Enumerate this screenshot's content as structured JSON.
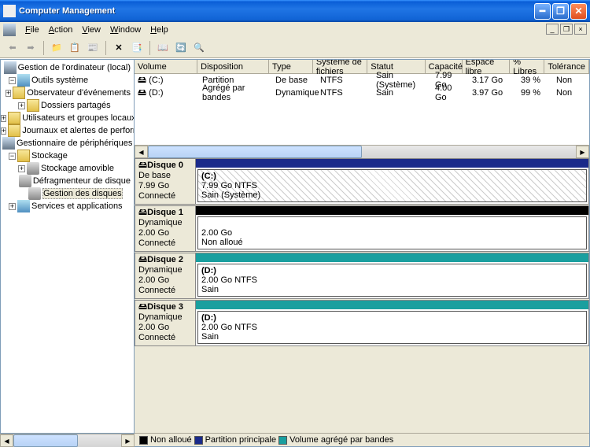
{
  "title": "Computer Management",
  "menubar": {
    "file": "File",
    "action": "Action",
    "view": "View",
    "window": "Window",
    "help": "Help"
  },
  "tree": {
    "root": "Gestion de l'ordinateur (local)",
    "outils": "Outils système",
    "obs": "Observateur d'événements",
    "dossiers": "Dossiers partagés",
    "users": "Utilisateurs et groupes locaux",
    "log": "Journaux et alertes de performance",
    "dev": "Gestionnaire de périphériques",
    "stockage": "Stockage",
    "amovible": "Stockage amovible",
    "defrag": "Défragmenteur de disque",
    "gestion": "Gestion des disques",
    "services": "Services et applications"
  },
  "vol_headers": {
    "volume": "Volume",
    "disposition": "Disposition",
    "type": "Type",
    "fs": "Système de fichiers",
    "statut": "Statut",
    "capacite": "Capacité",
    "libre": "Espace libre",
    "pct": "% Libres",
    "tol": "Tolérance"
  },
  "vols": [
    {
      "name": "(C:)",
      "dispo": "Partition",
      "type": "De base",
      "fs": "NTFS",
      "statut": "Sain (Système)",
      "cap": "7.99 Go",
      "libre": "3.17 Go",
      "pct": "39 %",
      "tol": "Non"
    },
    {
      "name": "(D:)",
      "dispo": "Agrégé par bandes",
      "type": "Dynamique",
      "fs": "NTFS",
      "statut": "Sain",
      "cap": "4.00 Go",
      "libre": "3.97 Go",
      "pct": "99 %",
      "tol": "Non"
    }
  ],
  "disks": [
    {
      "name": "Disque 0",
      "type": "De base",
      "size": "7.99 Go",
      "state": "Connecté",
      "color": "#1a2a8a",
      "part_name": "(C:)",
      "part_info": "7.99 Go NTFS",
      "part_status": "Sain (Système)",
      "hatched": true
    },
    {
      "name": "Disque 1",
      "type": "Dynamique",
      "size": "2.00 Go",
      "state": "Connecté",
      "color": "#000000",
      "part_name": "",
      "part_info": "2.00 Go",
      "part_status": "Non alloué",
      "hatched": false
    },
    {
      "name": "Disque 2",
      "type": "Dynamique",
      "size": "2.00 Go",
      "state": "Connecté",
      "color": "#1a9f9f",
      "part_name": "(D:)",
      "part_info": "2.00 Go NTFS",
      "part_status": "Sain",
      "hatched": false
    },
    {
      "name": "Disque 3",
      "type": "Dynamique",
      "size": "2.00 Go",
      "state": "Connecté",
      "color": "#1a9f9f",
      "part_name": "(D:)",
      "part_info": "2.00 Go NTFS",
      "part_status": "Sain",
      "hatched": false
    }
  ],
  "legend": {
    "unalloc": "Non alloué",
    "primary": "Partition principale",
    "striped": "Volume agrégé par bandes"
  },
  "legend_colors": {
    "unalloc": "#000000",
    "primary": "#1a2a8a",
    "striped": "#1a9f9f"
  }
}
